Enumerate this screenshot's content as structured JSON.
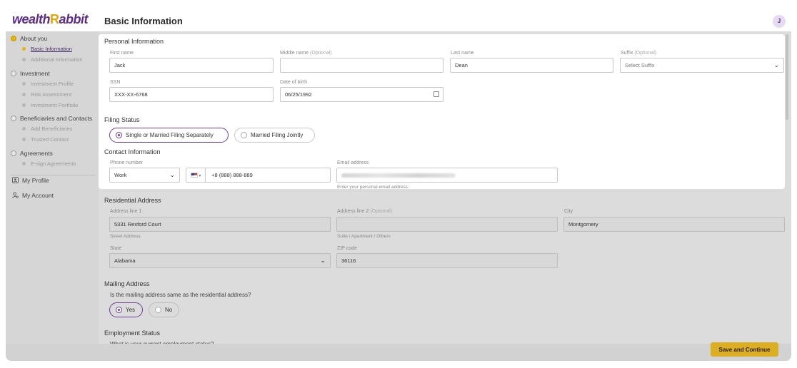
{
  "header": {
    "logo_left": "wealth",
    "logo_mid": "R",
    "logo_right": "abbit",
    "title": "Basic Information",
    "avatar": "J"
  },
  "sidebar": {
    "sections": [
      {
        "label": "About you",
        "subs": [
          "Basic Information",
          "Additional Information"
        ]
      },
      {
        "label": "Investment",
        "subs": [
          "Investment Profile",
          "Risk Assessment",
          "Investment Portfolio"
        ]
      },
      {
        "label": "Beneficiaries and Contacts",
        "subs": [
          "Add Beneficiaries",
          "Trusted Contact"
        ]
      },
      {
        "label": "Agreements",
        "subs": [
          "E-sign Agreements"
        ]
      }
    ],
    "links": [
      "My Profile",
      "My Account"
    ]
  },
  "personal": {
    "title": "Personal Information",
    "first_name_label": "First name",
    "first_name": "Jack",
    "middle_name_label": "Middle name",
    "middle_opt": "(Optional)",
    "middle_name": "",
    "last_name_label": "Last name",
    "last_name": "Dean",
    "suffix_label": "Suffix",
    "suffix_opt": "(Optional)",
    "suffix_placeholder": "Select Suffix",
    "ssn_label": "SSN",
    "ssn": "XXX-XX-6768",
    "dob_label": "Date of birth",
    "dob": "06/25/1992"
  },
  "filing": {
    "title": "Filing Status",
    "option1": "Single or Married Filing Separately",
    "option2": "Married Filing Jointly"
  },
  "contact": {
    "title": "Contact Information",
    "phone_label": "Phone number",
    "phone_type": "Work",
    "phone": "+8 (888) 888-889",
    "email_label": "Email address",
    "email_hint": "Enter your personal email address."
  },
  "residential": {
    "title": "Residential Address",
    "addr1_label": "Address line 1",
    "addr1": "5331 Rexford Court",
    "addr1_hint": "Street Address",
    "addr2_label": "Address line 2",
    "addr2_opt": "(Optional)",
    "addr2_hint": "Suite / Apartment / Others",
    "city_label": "City",
    "city": "Montgomery",
    "state_label": "State",
    "state": "Alabama",
    "zip_label": "ZIP code",
    "zip": "36116"
  },
  "mailing": {
    "title": "Mailing Address",
    "question": "Is the mailing address same as the residential address?",
    "yes": "Yes",
    "no": "No"
  },
  "employment": {
    "title": "Employment Status",
    "question": "What is your current employment status?"
  },
  "actions": {
    "save": "Save and Continue"
  }
}
